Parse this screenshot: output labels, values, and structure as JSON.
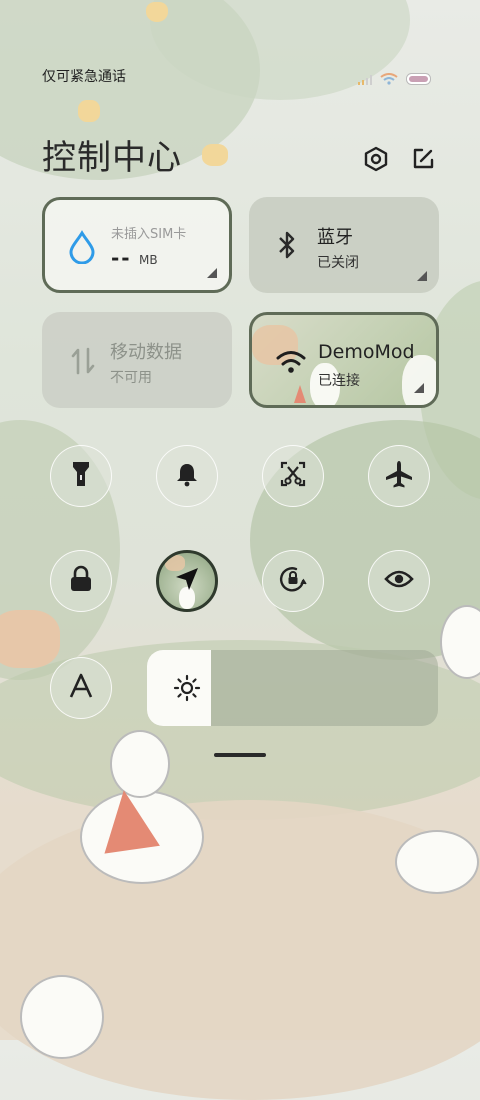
{
  "status": {
    "carrier_text": "仅可紧急通话",
    "signal_icon": "signal-bars-icon",
    "wifi_icon": "wifi-icon",
    "battery_icon": "battery-icon",
    "battery_color": "#c9a0b4"
  },
  "header": {
    "title": "控制中心",
    "settings_icon": "settings-hexagon-icon",
    "edit_icon": "edit-icon"
  },
  "tiles": {
    "data_usage": {
      "label": "未插入SIM卡",
      "value": "--",
      "unit": "MB",
      "icon": "water-drop-icon",
      "accent": "#2f9be8"
    },
    "bluetooth": {
      "label": "蓝牙",
      "sub": "已关闭",
      "icon": "bluetooth-icon"
    },
    "mobile_data": {
      "label": "移动数据",
      "sub": "不可用",
      "icon": "data-arrows-icon"
    },
    "wifi": {
      "label": "DemoMod",
      "sub": "已连接",
      "icon": "wifi-icon"
    }
  },
  "toggles": [
    {
      "name": "flashlight",
      "icon": "flashlight-icon",
      "active": false
    },
    {
      "name": "ringer",
      "icon": "bell-icon",
      "active": false
    },
    {
      "name": "screenshot",
      "icon": "scissors-screenshot-icon",
      "active": false
    },
    {
      "name": "airplane",
      "icon": "airplane-icon",
      "active": false
    },
    {
      "name": "lock-screen",
      "icon": "lock-icon",
      "active": false
    },
    {
      "name": "location",
      "icon": "location-arrow-icon",
      "active": true
    },
    {
      "name": "auto-rotate",
      "icon": "rotate-lock-icon",
      "active": false
    },
    {
      "name": "reading-mode",
      "icon": "eye-icon",
      "active": false
    },
    {
      "name": "font-size",
      "icon": "font-a-icon",
      "active": false
    }
  ],
  "brightness": {
    "level": 0.22,
    "icon": "sun-icon"
  }
}
